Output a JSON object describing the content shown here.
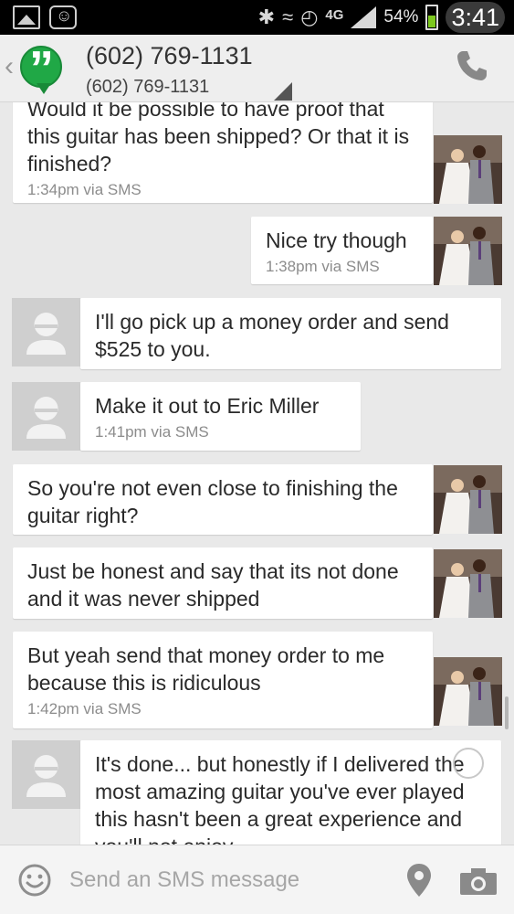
{
  "status_bar": {
    "time": "3:41",
    "battery_percent": "54%",
    "network": "4G",
    "icons": [
      "gallery-icon",
      "hangout-notification-icon",
      "bluetooth-icon",
      "vibrate-icon",
      "alarm-icon",
      "lte-icon",
      "signal-icon",
      "battery-icon"
    ]
  },
  "header": {
    "title": "(602) 769-1131",
    "subtitle": "(602) 769-1131",
    "icons": [
      "back-chevron-icon",
      "hangouts-logo-icon",
      "phone-icon"
    ]
  },
  "messages": [
    {
      "side": "me",
      "text": "Would it be possible to have proof that this guitar has been shipped? Or that it is finished?",
      "meta": "1:34pm via SMS"
    },
    {
      "side": "me",
      "text": "Nice try though",
      "meta": "1:38pm via SMS"
    },
    {
      "side": "them",
      "text": "I'll go pick up a money order and send $525 to you.",
      "meta": ""
    },
    {
      "side": "them",
      "text": "Make it out to Eric Miller",
      "meta": "1:41pm via SMS"
    },
    {
      "side": "me",
      "text": "So you're not even close to finishing the guitar right?",
      "meta": ""
    },
    {
      "side": "me",
      "text": "Just be honest and say that its not done and it was never shipped",
      "meta": ""
    },
    {
      "side": "me",
      "text": "But yeah send that money order to me because this is ridiculous",
      "meta": "1:42pm via SMS"
    },
    {
      "side": "them",
      "text": "It's done... but honestly if I delivered the most amazing guitar you've ever played this hasn't been a great experience and you'll not enjoy",
      "meta": ""
    }
  ],
  "compose": {
    "placeholder": "Send an SMS message",
    "icons": [
      "emoji-icon",
      "location-pin-icon",
      "camera-icon"
    ]
  },
  "colors": {
    "status_bar": "#000000",
    "background": "#e9e9e9",
    "bubble": "#ffffff",
    "hangouts_green": "#20a846",
    "battery_green": "#7dc81f"
  }
}
